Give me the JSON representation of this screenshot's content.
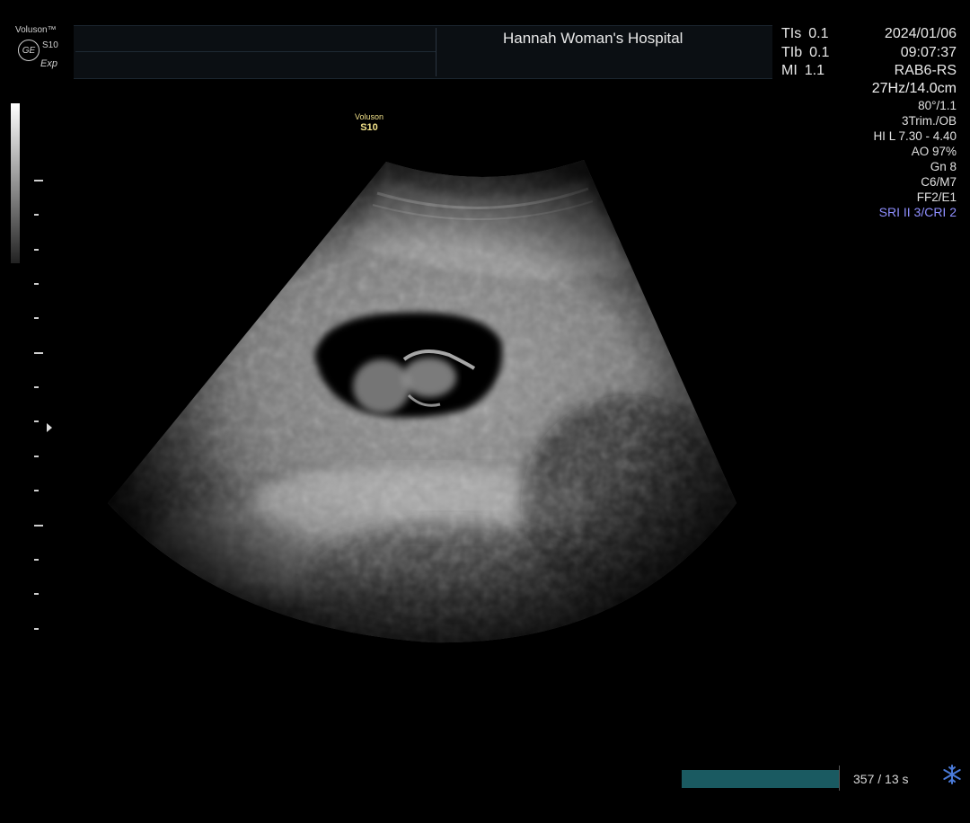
{
  "header": {
    "brand": "Voluson™",
    "model": "S10",
    "variant": "Exp",
    "logo_icon": "ge-logo-icon",
    "hospital": "Hannah Woman's Hospital",
    "tis_label": "TIs",
    "tis_value": "0.1",
    "tib_label": "TIb",
    "tib_value": "0.1",
    "mi_label": "MI",
    "mi_value": "1.1",
    "date": "2024/01/06",
    "time": "09:07:37",
    "probe": "RAB6-RS"
  },
  "params": {
    "frame_depth": "27Hz/14.0cm",
    "angle": "80°/1.1",
    "preset": "3Trim./OB",
    "hi": "HI L  7.30 - 4.40",
    "ao": "AO 97%",
    "gain": "Gn   8",
    "cm": "C6/M7",
    "ff": "FF2/E1",
    "sri": "SRI II 3/CRI 2"
  },
  "probe_label": {
    "brand": "Voluson",
    "model": "S10"
  },
  "cine": {
    "text": "357 / 13 s",
    "progress": 1.0,
    "freeze_icon": "snowflake-icon"
  },
  "colors": {
    "sri": "#8f8fff",
    "probe_label": "#f2e28a",
    "cine_bar": "#1a5a61"
  }
}
